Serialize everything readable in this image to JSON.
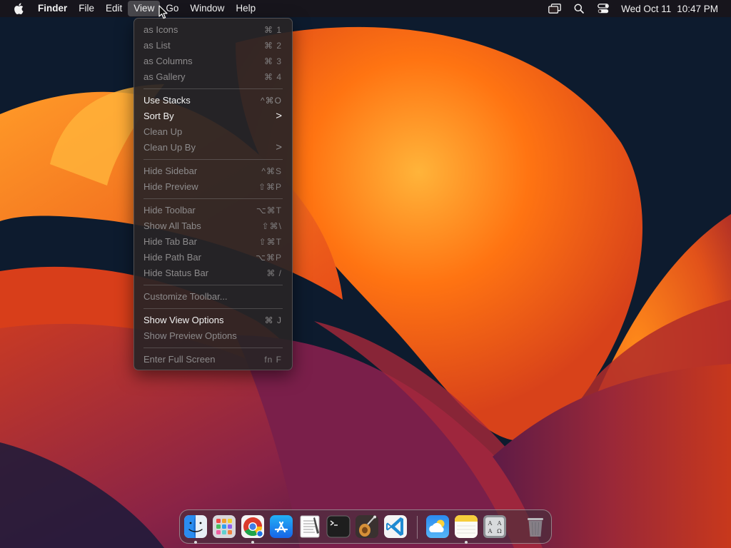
{
  "menubar": {
    "app_name": "Finder",
    "menus": [
      "File",
      "Edit",
      "View",
      "Go",
      "Window",
      "Help"
    ],
    "active_menu": "View",
    "clock_date": "Wed Oct 11",
    "clock_time": "10:47 PM",
    "status_icons": [
      "screen-mirroring-icon",
      "spotlight-search-icon",
      "control-center-icon"
    ]
  },
  "view_menu": {
    "items": [
      {
        "label": "as Icons",
        "shortcut": "⌘ 1",
        "enabled": false
      },
      {
        "label": "as List",
        "shortcut": "⌘ 2",
        "enabled": false
      },
      {
        "label": "as Columns",
        "shortcut": "⌘ 3",
        "enabled": false
      },
      {
        "label": "as Gallery",
        "shortcut": "⌘ 4",
        "enabled": false
      },
      {
        "label": "Use Stacks",
        "shortcut": "^⌘O",
        "enabled": true
      },
      {
        "label": "Sort By",
        "shortcut": ">",
        "enabled": true
      },
      {
        "label": "Clean Up",
        "shortcut": "",
        "enabled": false
      },
      {
        "label": "Clean Up By",
        "shortcut": ">",
        "enabled": false
      },
      {
        "label": "Hide Sidebar",
        "shortcut": "^⌘S",
        "enabled": false
      },
      {
        "label": "Hide Preview",
        "shortcut": "⇧⌘P",
        "enabled": false
      },
      {
        "label": "Hide Toolbar",
        "shortcut": "⌥⌘T",
        "enabled": false
      },
      {
        "label": "Show All Tabs",
        "shortcut": "⇧⌘\\",
        "enabled": false
      },
      {
        "label": "Hide Tab Bar",
        "shortcut": "⇧⌘T",
        "enabled": false
      },
      {
        "label": "Hide Path Bar",
        "shortcut": "⌥⌘P",
        "enabled": false
      },
      {
        "label": "Hide Status Bar",
        "shortcut": "⌘ /",
        "enabled": false
      },
      {
        "label": "Customize Toolbar...",
        "shortcut": "",
        "enabled": false
      },
      {
        "label": "Show View Options",
        "shortcut": "⌘ J",
        "enabled": true
      },
      {
        "label": "Show Preview Options",
        "shortcut": "",
        "enabled": false
      },
      {
        "label": "Enter Full Screen",
        "shortcut": "fn F",
        "enabled": false
      }
    ]
  },
  "dock": {
    "apps": [
      {
        "icon": "finder-icon",
        "running": true
      },
      {
        "icon": "launchpad-icon",
        "running": false
      },
      {
        "icon": "chrome-icon",
        "running": true
      },
      {
        "icon": "app-store-icon",
        "running": false
      },
      {
        "icon": "textedit-icon",
        "running": false
      },
      {
        "icon": "terminal-icon",
        "running": false
      },
      {
        "icon": "instruments-icon",
        "running": false
      },
      {
        "icon": "vscode-icon",
        "running": false
      },
      {
        "icon": "weather-icon",
        "running": false
      },
      {
        "icon": "notes-icon",
        "running": true
      },
      {
        "icon": "font-book-icon",
        "running": false
      },
      {
        "icon": "trash-icon",
        "running": false
      }
    ]
  },
  "colors": {
    "wallpaper_orange": "#ff7a12",
    "wallpaper_red": "#c8321a",
    "wallpaper_magenta": "#7a1f4a",
    "wallpaper_navy": "#0d1b2e"
  }
}
